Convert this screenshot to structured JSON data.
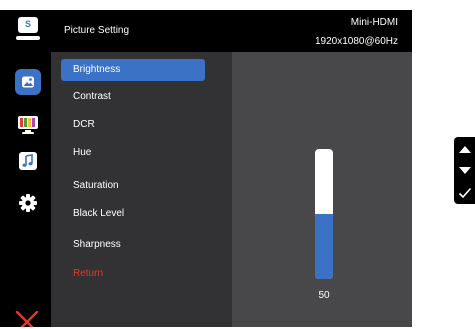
{
  "header": {
    "title": "Picture Setting",
    "input_source": "Mini-HDMI",
    "resolution": "1920x1080@60Hz",
    "logo_letter": "S",
    "logo_icon": "monitor-logo-icon"
  },
  "sidebar": {
    "items": [
      {
        "icon": "picture-icon",
        "active": true
      },
      {
        "icon": "color-bars-icon",
        "active": false
      },
      {
        "icon": "music-note-icon",
        "active": false
      },
      {
        "icon": "gear-icon",
        "active": false
      },
      {
        "icon": "close-icon",
        "active": false
      }
    ]
  },
  "menu": {
    "items": [
      {
        "label": "Brightness",
        "selected": true
      },
      {
        "label": "Contrast"
      },
      {
        "label": "DCR"
      },
      {
        "label": "Hue"
      },
      {
        "label": "Saturation"
      },
      {
        "label": "Black Level"
      },
      {
        "label": "Sharpness"
      },
      {
        "label": "Return",
        "color": "#e03a2f"
      }
    ]
  },
  "slider": {
    "value": "50",
    "fill_percent": 50
  },
  "side_keys": [
    {
      "icon": "arrow-up-icon"
    },
    {
      "icon": "arrow-down-icon"
    },
    {
      "icon": "checkmark-icon"
    }
  ],
  "colors": {
    "accent": "#3b72c5",
    "return": "#e03a2f",
    "close": "#e03a2f"
  }
}
